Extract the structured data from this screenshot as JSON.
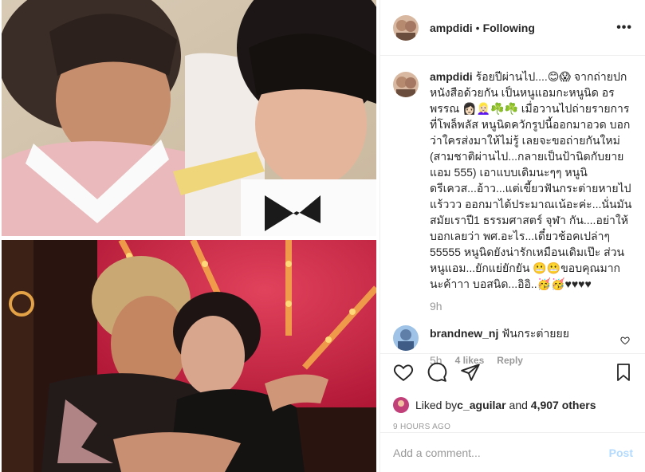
{
  "header": {
    "username": "ampdidi",
    "separator": "•",
    "follow_state": "Following",
    "more_label": "•••"
  },
  "caption": {
    "username": "ampdidi",
    "text": "ร้อยปีผ่านไป....😊😱 จากถ่ายปกหนังสือด้วยกัน เป็นหนูแอมกะหนูนิด อรพรรณ 👩🏻👱🏻‍♀️☘️☘️ เมื่อวานไปถ่ายรายการที่โพล็พลัส หนูนิดควักรูปนี้ออกมาอวด บอกว่าใครส่งมาให้ไม่รู้ เลยจะขอถ่ายกันใหม่ (สามชาติผ่านไป...กลายเป็นป้านิดกับยายแอม 555) เอาแบบเดิมนะๆๆ หนูนิดรีเควส...อ้าว...แต่เขี้ยวฟันกระต่ายหายไปแร้ววว ออกมาได้ประมาณเน้อะค่ะ...นั่นมันสมัยเราปี1 ธรรมศาสตร์ จุฬา กัน....อย่าให้บอกเลยว่า พศ.อะไร...เดี๋ยวช้อคเปล่าๆ 55555 หนูนิดยังน่ารักเหมือนเดิมเป๊ะ ส่วนหนูแอม...ยักแย่ยักยัน 😬😬ขอบคุณมากนะค้าาา บอสนิด...อิอิ..🥳🥳♥♥♥♥",
    "age": "9h"
  },
  "reply": {
    "username": "brandnew_nj",
    "text": "ฟันกระต่ายยย",
    "age": "5h",
    "likes": "4 likes",
    "reply_label": "Reply"
  },
  "actions": {
    "liked_by_prefix": "Liked by ",
    "liked_by_user": "c_aguilar",
    "liked_by_mid": " and ",
    "liked_count": "4,907 others",
    "timestamp": "9 HOURS AGO"
  },
  "comment_box": {
    "placeholder": "Add a comment...",
    "post_label": "Post"
  },
  "icons": [
    "heart-icon",
    "comment-icon",
    "share-icon",
    "bookmark-icon",
    "more-icon"
  ],
  "colors": {
    "link_disabled": "#b3dbff",
    "muted": "#999999",
    "text": "#262626"
  }
}
